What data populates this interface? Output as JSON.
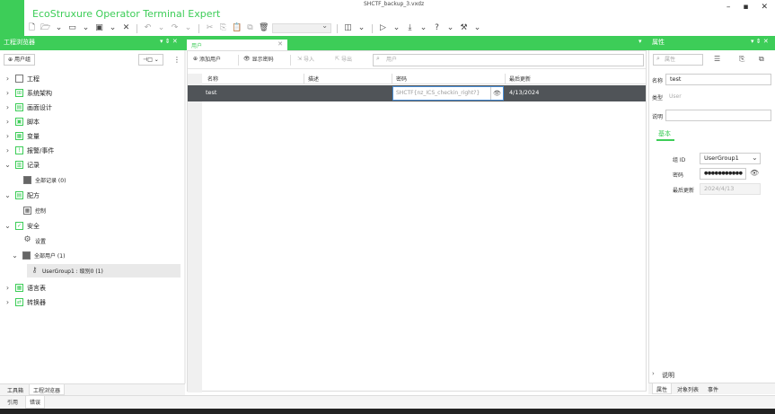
{
  "window": {
    "app_title": "EcoStruxure Operator Terminal Expert",
    "file_title": "SHCTF_backup_3.vxdz",
    "minimize": "–",
    "maximize": "▪",
    "close": "✕"
  },
  "panels": {
    "left_title": "工程浏览器",
    "right_title": "属性",
    "pin": "▾ ⇕ ✕"
  },
  "tab": {
    "label": "用户",
    "close": "✕"
  },
  "left": {
    "user_group_button": "用户组",
    "view_button": "⊣□ ⌄",
    "more": "⋮",
    "tree": [
      {
        "label": "工程",
        "icon": "project-icon"
      },
      {
        "label": "系统架构",
        "icon": "architecture-icon"
      },
      {
        "label": "画面设计",
        "icon": "screen-design-icon"
      },
      {
        "label": "脚本",
        "icon": "script-icon"
      },
      {
        "label": "变量",
        "icon": "variable-icon"
      },
      {
        "label": "报警/事件",
        "icon": "alarm-icon"
      },
      {
        "label": "记录",
        "icon": "record-icon"
      },
      {
        "label": "全部记录 (0)",
        "icon": "folder-icon"
      },
      {
        "label": "配方",
        "icon": "recipe-icon"
      },
      {
        "label": "控制",
        "icon": "control-icon"
      },
      {
        "label": "安全",
        "icon": "security-icon"
      },
      {
        "label": "设置",
        "icon": "gear-icon"
      },
      {
        "label": "全部用户 (1)",
        "icon": "folder-icon"
      },
      {
        "label": "UserGroup1 : 级别0 (1)",
        "icon": "key-icon"
      },
      {
        "label": "语言表",
        "icon": "language-icon"
      },
      {
        "label": "转换器",
        "icon": "converter-icon"
      }
    ],
    "bottom_tabs": [
      "工具箱",
      "工程浏览器"
    ]
  },
  "status_tabs": [
    "引用",
    "错误"
  ],
  "center": {
    "toolbar": {
      "add_user": "添加用户",
      "show_password": "显示密码",
      "import": "导入",
      "export": "导出",
      "search_placeholder": "用户"
    },
    "columns": [
      "名称",
      "描述",
      "密码",
      "最后更新"
    ],
    "rows": [
      {
        "name": "test",
        "description": "",
        "password": "SHCTF{nz_ICS_checkin_right?}",
        "last_update": "4/13/2024"
      }
    ]
  },
  "right": {
    "search_placeholder": "属性",
    "name_label": "名称",
    "name_value": "test",
    "type_label": "类型",
    "type_value": "User",
    "desc_label": "说明",
    "desc_value": "",
    "section_basic": "基本",
    "group_label": "组 ID",
    "group_value": "UserGroup1",
    "password_label": "密码",
    "password_value": "●●●●●●●●●●●",
    "last_update_label": "最后更新",
    "last_update_value": "2024/4/13",
    "section_desc": "说明",
    "bottom_tabs": [
      "属性",
      "对象列表",
      "事件"
    ]
  }
}
